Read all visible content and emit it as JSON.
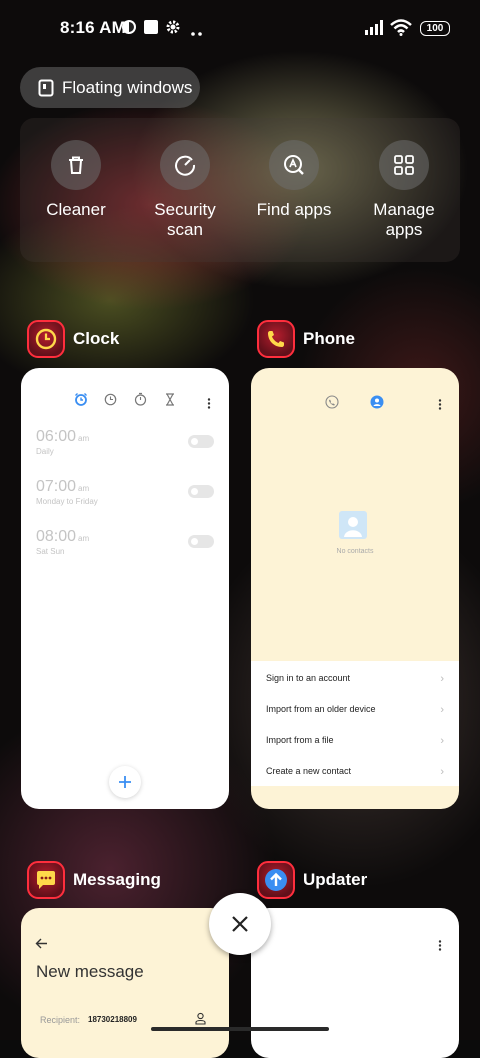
{
  "status_bar": {
    "time": "8:16 AM",
    "battery": "100",
    "icons": [
      "vpn-icon",
      "square-icon",
      "gear-icon",
      "more-dots-icon",
      "signal-icon",
      "wifi-icon",
      "battery-icon"
    ]
  },
  "floating_windows": {
    "label": "Floating windows"
  },
  "actions": [
    {
      "label": "Cleaner",
      "icon": "trash-icon"
    },
    {
      "label": "Security scan",
      "icon": "gauge-icon"
    },
    {
      "label": "Find apps",
      "icon": "search-a-icon"
    },
    {
      "label": "Manage apps",
      "icon": "grid-icon"
    }
  ],
  "apps": {
    "clock": {
      "name": "Clock",
      "alarms": [
        {
          "time": "06:00",
          "ampm": "am",
          "repeat": "Daily"
        },
        {
          "time": "07:00",
          "ampm": "am",
          "repeat": "Monday to Friday"
        },
        {
          "time": "08:00",
          "ampm": "am",
          "repeat": "Sat Sun"
        }
      ]
    },
    "phone": {
      "name": "Phone",
      "empty_text": "No contacts",
      "menu": [
        "Sign in to an account",
        "Import from an older device",
        "Import from a file",
        "Create a new contact"
      ]
    },
    "messaging": {
      "name": "Messaging",
      "title": "New message",
      "recipient_label": "Recipient:",
      "recipient_value": "18730218809"
    },
    "updater": {
      "name": "Updater"
    }
  },
  "colors": {
    "accent_blue": "#3a8ef2",
    "app_icon_red": "#ff2e3d",
    "phone_bg": "#fdf3d6"
  }
}
